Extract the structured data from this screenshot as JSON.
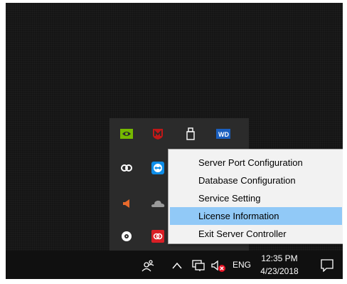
{
  "context_menu": {
    "items": [
      {
        "label": "Server Port Configuration",
        "highlighted": false
      },
      {
        "label": "Database Configuration",
        "highlighted": false
      },
      {
        "label": "Service Setting",
        "highlighted": false
      },
      {
        "label": "License Information",
        "highlighted": true
      },
      {
        "label": "Exit Server Controller",
        "highlighted": false
      }
    ]
  },
  "tray_popup": {
    "icons": [
      "nvidia-icon",
      "mcafee-icon",
      "usb-drive-icon",
      "wd-icon",
      "creative-cloud-icon",
      "teamviewer-icon",
      "audio-icon",
      "onedrive-icon",
      "disc-icon",
      "adobe-icon"
    ]
  },
  "taskbar": {
    "icons": [
      "people-icon",
      "chevron-up-icon",
      "network-icon",
      "volume-muted-icon",
      "action-center-icon"
    ],
    "language": "ENG",
    "time": "12:35 PM",
    "date": "4/23/2018"
  },
  "colors": {
    "menu_highlight": "#91c9f7",
    "menu_background": "#f2f2f2",
    "taskbar": "#101010",
    "tray_popup": "#2b2b2b"
  }
}
